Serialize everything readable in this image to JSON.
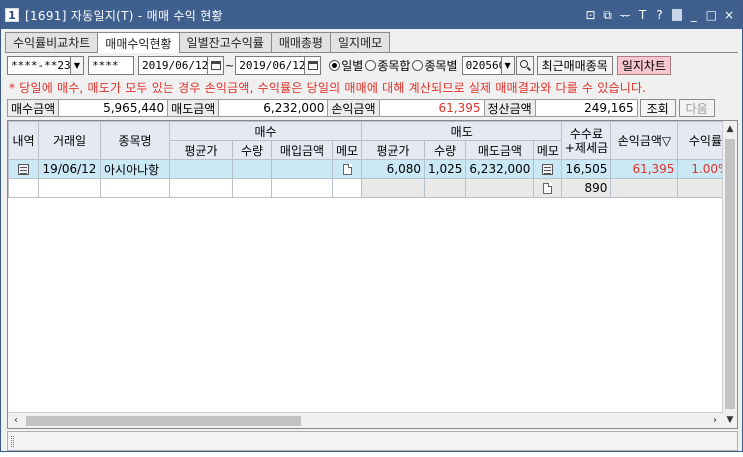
{
  "window": {
    "screen_no": "1",
    "title": "[1691] 자동일지(T) - 매매 수익 현황",
    "controls": [
      "⊡",
      "⧉",
      "ᅲ",
      "T",
      "?",
      "_",
      "□",
      "×"
    ]
  },
  "tabs": [
    {
      "label": "수익률비교차트",
      "active": false
    },
    {
      "label": "매매수익현황",
      "active": true
    },
    {
      "label": "일별잔고수익률",
      "active": false
    },
    {
      "label": "매매총평",
      "active": false
    },
    {
      "label": "일지메모",
      "active": false
    }
  ],
  "filter": {
    "account": "****-**23",
    "password": "****",
    "date_from": "2019/06/12",
    "date_sep": "~",
    "date_to": "2019/06/12",
    "radios": [
      {
        "label": "일별",
        "selected": true
      },
      {
        "label": "종목합",
        "selected": false
      },
      {
        "label": "종목별",
        "selected": false
      }
    ],
    "stock_code": "020560",
    "recent_button": "최근매매종목",
    "chart_button": "일지차트"
  },
  "notice": "* 당일에 매수, 매도가 모두 있는 경우 손익금액, 수익률은 당일의 매매에 대해 계산되므로 실제 매매결과와 다를 수 있습니다.",
  "summary": {
    "buy_label": "매수금액",
    "buy_value": "5,965,440",
    "sell_label": "매도금액",
    "sell_value": "6,232,000",
    "pl_label": "손익금액",
    "pl_value": "61,395",
    "settle_label": "정산금액",
    "settle_value": "249,165",
    "query_button": "조회",
    "next_button": "다음"
  },
  "grid": {
    "headers": {
      "detail": "내역",
      "date": "거래일",
      "name": "종목명",
      "buy_group": "매수",
      "sell_group": "매도",
      "fee": "수수료\n+제세금",
      "pl": "손익금액",
      "rate": "수익률",
      "avg": "평균가",
      "qty": "수량",
      "buy_amt": "매입금액",
      "memo": "메모",
      "sell_amt": "매도금액"
    },
    "row1": {
      "date": "19/06/12",
      "name": "아시아나항",
      "sell_avg": "6,080",
      "sell_qty": "1,025",
      "sell_amt": "6,232,000",
      "fee": "16,505",
      "pl": "61,395",
      "rate": "1.00%"
    },
    "row2": {
      "fee": "890"
    }
  },
  "colors": {
    "title_bg": "#3f5f8f",
    "red_text": "#e0322a",
    "selected_row": "#cbe8f5",
    "chart_button": "#f7c8cf"
  }
}
